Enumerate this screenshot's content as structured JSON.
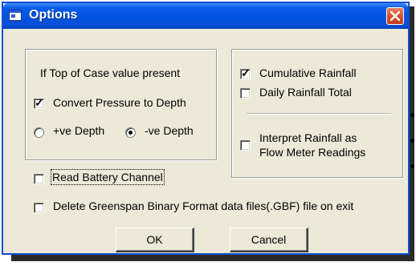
{
  "window": {
    "title": "Options",
    "close_icon": "close-icon",
    "app_icon": "window-icon"
  },
  "top_of_case": {
    "heading": "If Top of Case value present",
    "convert_label": "Convert Pressure to Depth",
    "convert_checked": true,
    "pos_depth_label": "+ve Depth",
    "pos_depth_selected": false,
    "neg_depth_label": "-ve Depth",
    "neg_depth_selected": true
  },
  "rainfall": {
    "cumulative_label": "Cumulative Rainfall",
    "cumulative_checked": true,
    "daily_label": "Daily Rainfall Total",
    "daily_checked": false,
    "interpret_line1": "Interpret Rainfall as",
    "interpret_line2": "Flow Meter Readings",
    "interpret_checked": false
  },
  "read_battery_label": "Read Battery Channel",
  "read_battery_checked": false,
  "delete_gbf_label": "Delete Greenspan Binary Format data files(.GBF) file on exit",
  "delete_gbf_checked": false,
  "buttons": {
    "ok": "OK",
    "cancel": "Cancel"
  },
  "colors": {
    "titlebar": "#0054e3",
    "close": "#d5502f",
    "face": "#ece9d8"
  }
}
